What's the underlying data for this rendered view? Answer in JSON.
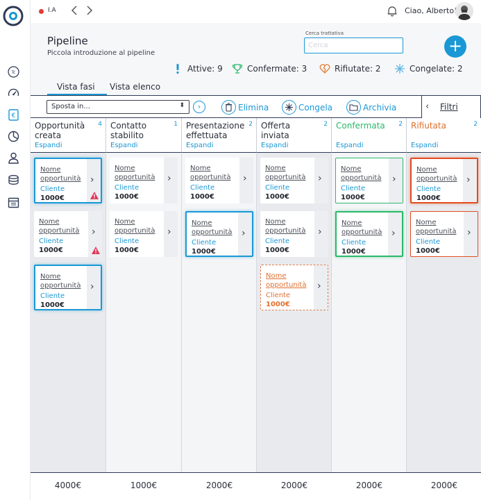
{
  "topbar": {
    "ia_label": "I.A",
    "greeting": "Ciao, Alberto!"
  },
  "header": {
    "title": "Pipeline",
    "subtitle": "Piccola introduzione al pipeline",
    "search_label": "Cerca trattativa",
    "search_placeholder": "Cerca",
    "add_label": "+"
  },
  "stats": [
    {
      "label": "Attive: 9",
      "icon": "exclamation-icon",
      "color": "#1a98d5"
    },
    {
      "label": "Confermate: 3",
      "icon": "trophy-icon",
      "color": "#2ab86a"
    },
    {
      "label": "Rifiutate: 2",
      "icon": "broken-heart-icon",
      "color": "#e07a2f"
    },
    {
      "label": "Congelate: 2",
      "icon": "snowflake-icon",
      "color": "#5fb8e8"
    }
  ],
  "tabs": [
    {
      "label": "Vista fasi",
      "active": true
    },
    {
      "label": "Vista elenco",
      "active": false
    }
  ],
  "toolbar": {
    "move_select": "Sposta in...",
    "delete_label": "Elimina",
    "freeze_label": "Congela",
    "archive_label": "Archivia",
    "filters_label": "Filtri"
  },
  "columns": [
    {
      "title": "Opportunità creata",
      "count": "4",
      "expand": "Espandi",
      "total": "4000€",
      "title_color": "#2b2f3a"
    },
    {
      "title": "Contatto stabilito",
      "count": "1",
      "expand": "Espandi",
      "total": "1000€",
      "title_color": "#2b2f3a"
    },
    {
      "title": "Presentazione effettuata",
      "count": "2",
      "expand": "Espandi",
      "total": "2000€",
      "title_color": "#2b2f3a"
    },
    {
      "title": "Offerta inviata",
      "count": "2",
      "expand": "Espandi",
      "total": "2000€",
      "title_color": "#2b2f3a"
    },
    {
      "title": "Confermata",
      "count": "2",
      "expand": "Espandi",
      "total": "2000€",
      "title_color": "#2ab86a"
    },
    {
      "title": "Rifiutata",
      "count": "2",
      "expand": "Espandi",
      "total": "2000€",
      "title_color": "#e0702f"
    }
  ],
  "card": {
    "name": "Nome opportunità",
    "client": "Cliente",
    "amount": "1000€"
  }
}
